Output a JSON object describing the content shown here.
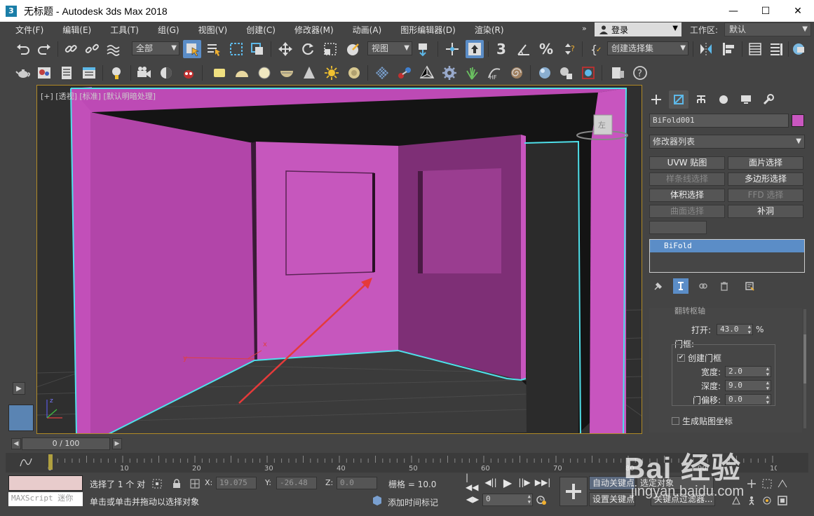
{
  "window": {
    "app_icon": "3",
    "title": "无标题 - Autodesk 3ds Max 2018",
    "minimize": "—",
    "maximize": "☐",
    "close": "✕"
  },
  "menubar": {
    "items": [
      "文件(F)",
      "编辑(E)",
      "工具(T)",
      "组(G)",
      "视图(V)",
      "创建(C)",
      "修改器(M)",
      "动画(A)",
      "图形编辑器(D)",
      "渲染(R)"
    ],
    "overflow": "»",
    "login": "登录",
    "workspace_label": "工作区:",
    "workspace_value": "默认"
  },
  "toolbar1": {
    "selection_filter": "全部",
    "ref_coord": "视图",
    "named_selection": "创建选择集",
    "snap_3": "3",
    "snap_percent": "%"
  },
  "viewport": {
    "label": "[+] [透视] [标准] [默认明暗处理]",
    "gizmo_label": "左",
    "axis_x": "x",
    "axis_y": "y",
    "axis_z": "z"
  },
  "command_panel": {
    "object_name": "BiFold001",
    "object_color": "#c957c0",
    "modifier_list": "修改器列表",
    "modifier_buttons": [
      {
        "label": "UVW 贴图",
        "enabled": true
      },
      {
        "label": "面片选择",
        "enabled": true
      },
      {
        "label": "样条线选择",
        "enabled": false
      },
      {
        "label": "多边形选择",
        "enabled": true
      },
      {
        "label": "体积选择",
        "enabled": true
      },
      {
        "label": "FFD 选择",
        "enabled": false
      },
      {
        "label": "曲面选择",
        "enabled": false
      },
      {
        "label": "补洞",
        "enabled": true
      }
    ],
    "stack_item": "BiFold",
    "params": {
      "rollout_title": "翻转枢轴",
      "open_label": "打开:",
      "open_value": "43.0",
      "open_unit": "%",
      "frame_group": "门框:",
      "create_frame": "创建门框",
      "create_frame_checked": true,
      "width_label": "宽度:",
      "width_value": "2.0",
      "depth_label": "深度:",
      "depth_value": "9.0",
      "offset_label": "门偏移:",
      "offset_value": "0.0",
      "gen_mapping": "生成贴图坐标"
    }
  },
  "time": {
    "slider": "0 / 100",
    "ticks": [
      "0",
      "10",
      "20",
      "30",
      "40",
      "50",
      "60",
      "70",
      "80",
      "90",
      "100"
    ]
  },
  "status": {
    "maxscript": "MAXScript 迷你",
    "selected": "选择了 1 个 对",
    "prompt": "单击或单击并拖动以选择对象",
    "x_label": "X:",
    "x_value": "19.075",
    "y_label": "Y:",
    "y_value": "-26.48",
    "z_label": "Z:",
    "z_value": "0.0",
    "grid": "栅格 = 10.0",
    "add_time_tag": "添加时间标记",
    "auto_key": "自动关键点",
    "selected_obj": "选定对象",
    "set_key": "设置关键点",
    "key_filters": "关键点过滤器...",
    "frame": "0"
  },
  "watermark": {
    "logo": "Bai  经验",
    "url": "jingyan.baidu.com"
  }
}
